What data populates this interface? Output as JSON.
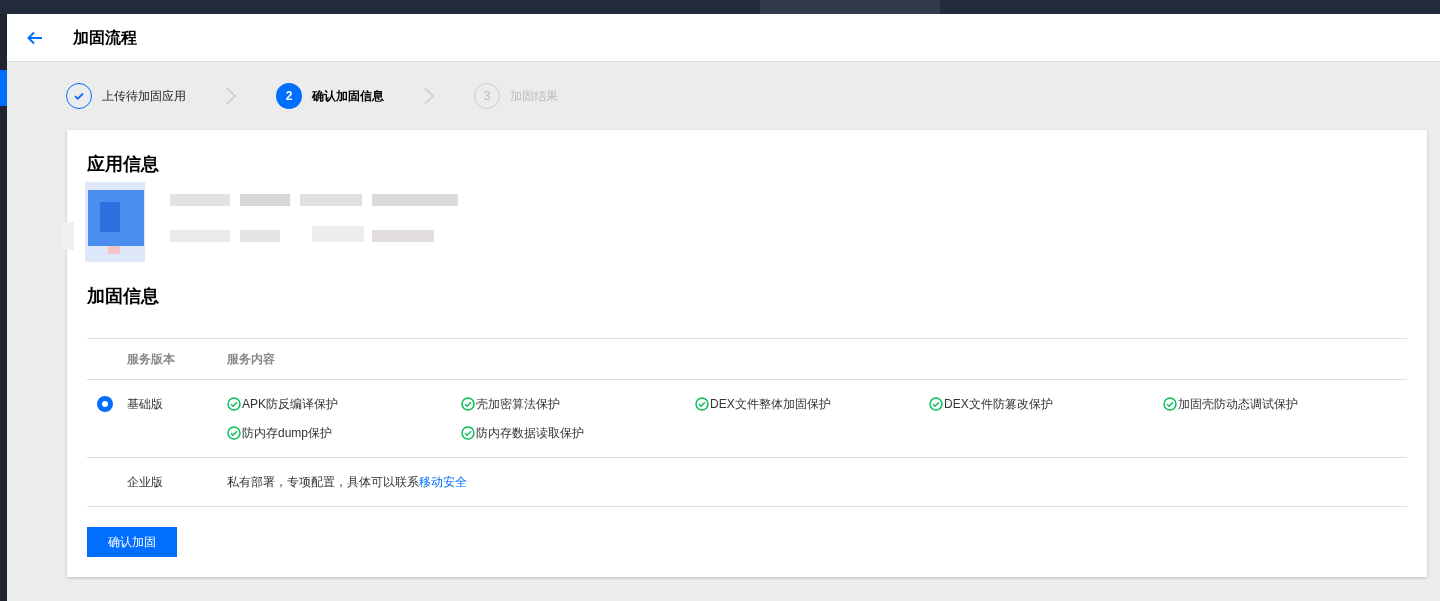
{
  "header": {
    "title": "加固流程"
  },
  "steps": [
    {
      "label": "上传待加固应用",
      "done": true,
      "selected": false
    },
    {
      "label": "确认加固信息",
      "number": "2",
      "done": false,
      "selected": true
    },
    {
      "label": "加固结果",
      "number": "3",
      "done": false,
      "selected": false
    }
  ],
  "app_info": {
    "title": "应用信息"
  },
  "hardening": {
    "title": "加固信息",
    "columns": [
      "服务版本",
      "服务内容"
    ],
    "plans": [
      {
        "kind": "option",
        "name": "基础版",
        "selected": true,
        "features": [
          "APK防反编译保护",
          "壳加密算法保护",
          "DEX文件整体加固保护",
          "DEX文件防篡改保护",
          "加固壳防动态调试保护",
          "防内存dump保护",
          "防内存数据读取保护"
        ]
      },
      {
        "kind": "contact",
        "name": "企业版",
        "text": "私有部署，专项配置，具体可以联系",
        "link": "移动安全"
      }
    ]
  },
  "confirm_button": "确认加固"
}
